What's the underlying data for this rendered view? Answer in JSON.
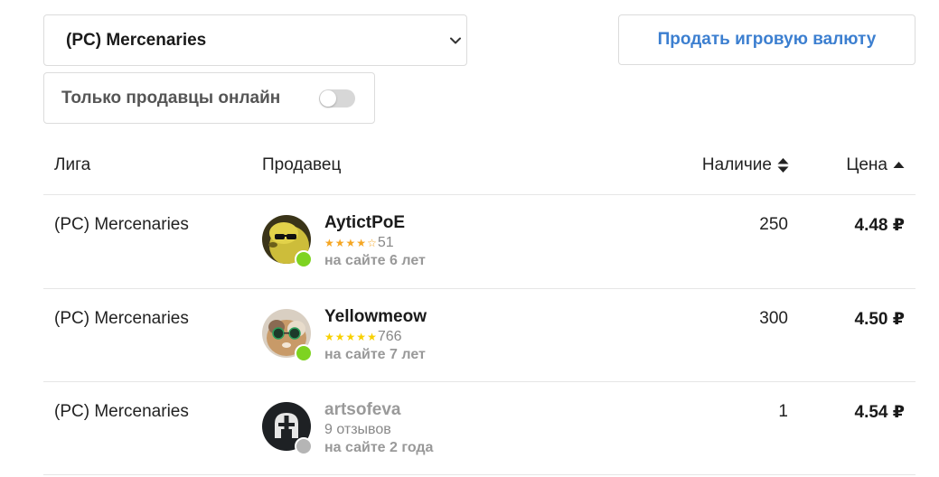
{
  "filters": {
    "league_select": {
      "value": "(PC) Mercenaries"
    },
    "sell_button_label": "Продать игровую валюту",
    "online_only": {
      "label": "Только продавцы онлайн",
      "enabled": false
    }
  },
  "table": {
    "headers": {
      "league": "Лига",
      "seller": "Продавец",
      "stock": "Наличие",
      "price": "Цена"
    },
    "rows": [
      {
        "league": "(PC) Mercenaries",
        "seller": "AytictPoE",
        "rating_stars": 4,
        "reviews": "51",
        "on_site": "на сайте 6 лет",
        "online": true,
        "stock": "250",
        "price": "4.48 ₽"
      },
      {
        "league": "(PC) Mercenaries",
        "seller": "Yellowmeow",
        "rating_stars": 5,
        "reviews": "766",
        "on_site": "на сайте 7 лет",
        "online": true,
        "stock": "300",
        "price": "4.50 ₽"
      },
      {
        "league": "(PC) Mercenaries",
        "seller": "artsofeva",
        "reviews": "9 отзывов",
        "on_site": "на сайте 2 года",
        "online": false,
        "stock": "1",
        "price": "4.54 ₽"
      }
    ]
  },
  "colors": {
    "accent_link": "#3c7fd0",
    "online": "#7ed321",
    "offline": "#b5b5b5",
    "star_orange": "#f5a623",
    "star_yellow": "#f8d000"
  }
}
